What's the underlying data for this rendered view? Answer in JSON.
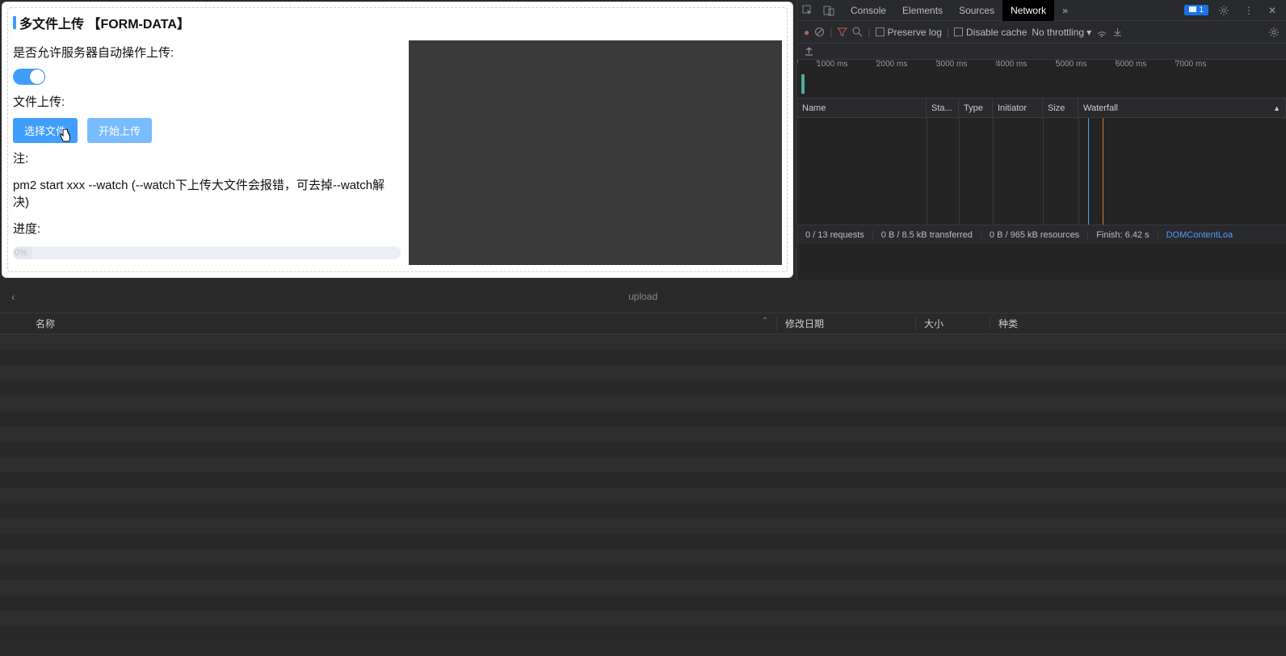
{
  "form": {
    "title": "多文件上传 【FORM-DATA】",
    "allow_server_auto_label": "是否允许服务器自动操作上传:",
    "file_upload_label": "文件上传:",
    "select_file_btn": "选择文件",
    "start_upload_btn": "开始上传",
    "note_label": "注:",
    "note_text": "pm2 start xxx --watch (--watch下上传大文件会报错，可去掉--watch解决)",
    "progress_label": "进度:",
    "progress_value": "0%"
  },
  "devtools": {
    "tabs": {
      "console": "Console",
      "elements": "Elements",
      "sources": "Sources",
      "network": "Network"
    },
    "issues_badge": "1",
    "toolbar": {
      "preserve_log": "Preserve log",
      "disable_cache": "Disable cache",
      "throttling": "No throttling"
    },
    "timeline_ticks": [
      "1000 ms",
      "2000 ms",
      "3000 ms",
      "4000 ms",
      "5000 ms",
      "6000 ms",
      "7000 ms"
    ],
    "network_columns": {
      "name": "Name",
      "status": "Sta...",
      "type": "Type",
      "initiator": "Initiator",
      "size": "Size",
      "waterfall": "Waterfall"
    },
    "status": {
      "requests": "0 / 13 requests",
      "transferred": "0 B / 8.5 kB transferred",
      "resources": "0 B / 965 kB resources",
      "finish": "Finish: 6.42 s",
      "dcl": "DOMContentLoa"
    }
  },
  "filebrowser": {
    "breadcrumb": "upload",
    "columns": {
      "name": "名称",
      "date": "修改日期",
      "size": "大小",
      "kind": "种类"
    }
  }
}
